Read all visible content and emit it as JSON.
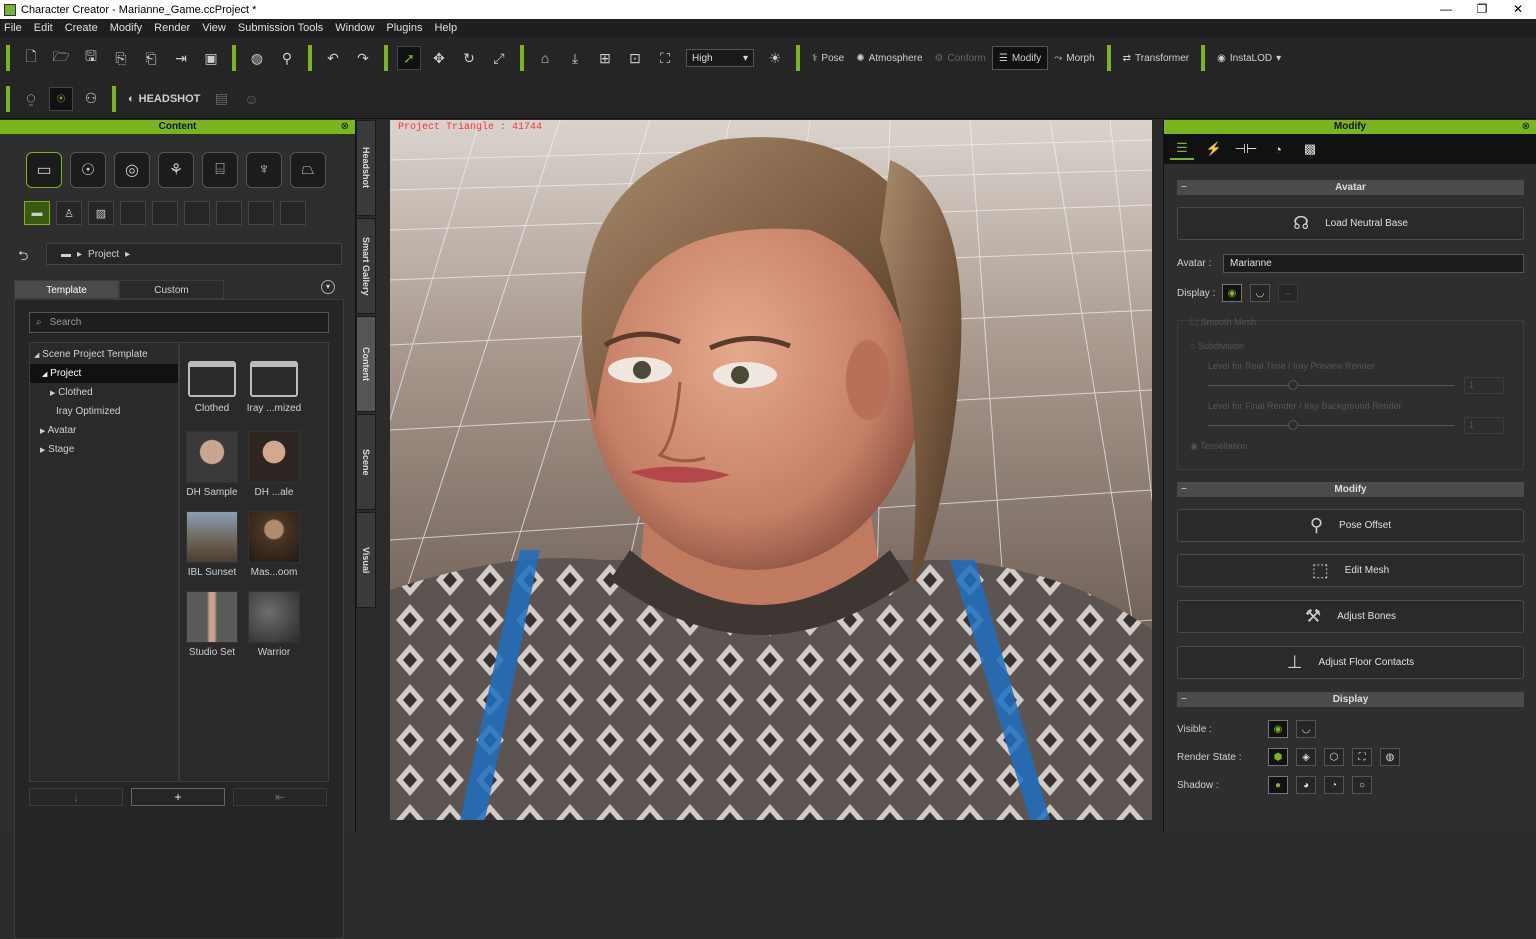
{
  "window": {
    "title": "Character Creator - Marianne_Game.ccProject *",
    "buttons": [
      "—",
      "❐",
      "✕"
    ]
  },
  "menu": [
    "File",
    "Edit",
    "Create",
    "Modify",
    "Render",
    "View",
    "Submission Tools",
    "Window",
    "Plugins",
    "Help"
  ],
  "toolbar": {
    "quality": "High",
    "pose": "Pose",
    "atmosphere": "Atmosphere",
    "conform": "Conform",
    "modify": "Modify",
    "morph": "Morph",
    "transformer": "Transformer",
    "instalod": "InstaLOD"
  },
  "toolbar2": {
    "headshot": "HEADSHOT"
  },
  "content": {
    "title": "Content",
    "breadcrumb": "Project",
    "tabs": [
      "Template",
      "Custom"
    ],
    "search_placeholder": "Search",
    "tree": [
      {
        "label": "Scene Project Template",
        "arrow": "◢"
      },
      {
        "label": "Project",
        "arrow": "◢"
      },
      {
        "label": "Clothed",
        "arrow": "▶"
      },
      {
        "label": "Iray Optimized",
        "arrow": ""
      },
      {
        "label": "Avatar",
        "arrow": "▶"
      },
      {
        "label": "Stage",
        "arrow": "▶"
      }
    ],
    "items": [
      {
        "label": "Clothed"
      },
      {
        "label": "Iray ...mized"
      },
      {
        "label": "DH Sample"
      },
      {
        "label": "DH ...ale"
      },
      {
        "label": "IBL Sunset"
      },
      {
        "label": "Mas...oom"
      },
      {
        "label": "Studio Set"
      },
      {
        "label": "Warrior"
      }
    ]
  },
  "side_tabs": [
    "Headshot",
    "Smart Gallery",
    "Content",
    "Scene",
    "Visual"
  ],
  "viewport": {
    "overlay": "Project Triangle : 41744"
  },
  "modify": {
    "title": "Modify",
    "avatar_section": "Avatar",
    "load_neutral": "Load Neutral Base",
    "avatar_label": "Avatar :",
    "avatar_value": "Marianne",
    "display_label": "Display :",
    "smooth_mesh": "Smooth Mesh",
    "subdivision": "Subdivision",
    "level_realtime": "Level for Real Time / Iray Preview Render",
    "level_final": "Level for Final Render / Iray Background Render",
    "tessellation": "Tessellation",
    "spin_value": "1",
    "modify_section": "Modify",
    "pose_offset": "Pose Offset",
    "edit_mesh": "Edit Mesh",
    "adjust_bones": "Adjust Bones",
    "adjust_floor": "Adjust Floor Contacts",
    "display_section": "Display",
    "visible_label": "Visible :",
    "render_state_label": "Render State :",
    "shadow_label": "Shadow :"
  },
  "colors": {
    "accent": "#7ab51d",
    "panel": "#2e2e2e",
    "overlay": "#ff3030"
  }
}
